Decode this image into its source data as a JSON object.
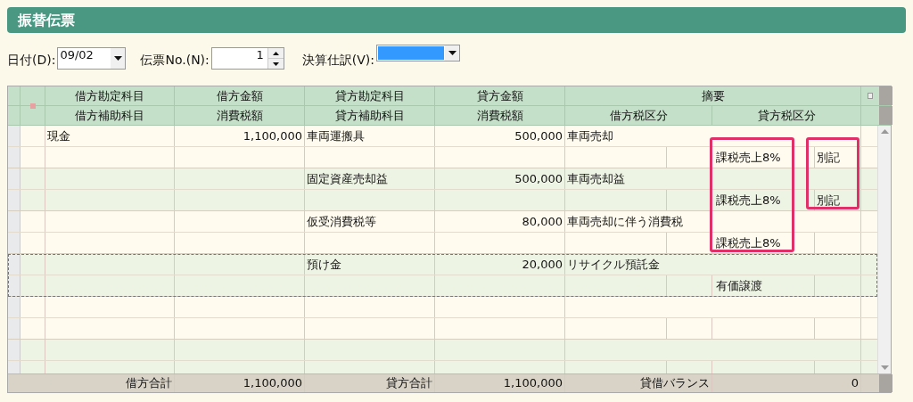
{
  "title": "振替伝票",
  "form": {
    "date": {
      "label": "日付(D):",
      "value": "09/02"
    },
    "slip_no": {
      "label": "伝票No.(N):",
      "value": "1"
    },
    "closing_entry": {
      "label": "決算仕訳(V):"
    }
  },
  "table": {
    "header_top": [
      "借方勘定科目",
      "借方金額",
      "貸方勘定科目",
      "貸方金額",
      "摘要"
    ],
    "header_bottom": [
      "借方補助科目",
      "消費税額",
      "貸方補助科目",
      "消費税額",
      "借方税区分",
      "貸方税区分"
    ],
    "entries": [
      {
        "debit_account": "現金",
        "debit_amount": "1,100,000",
        "credit_account": "車両運搬具",
        "credit_amount": "500,000",
        "summary": "車両売却",
        "credit_tax_1": "課税売上8%",
        "credit_tax_2": "別記",
        "selected": false,
        "tax_class_highlighted": true,
        "tax_note_highlighted": true
      },
      {
        "credit_account": "固定資産売却益",
        "credit_amount": "500,000",
        "summary": "車両売却益",
        "credit_tax_1": "課税売上8%",
        "credit_tax_2": "別記",
        "selected": false,
        "tax_class_highlighted": true,
        "tax_note_highlighted": true
      },
      {
        "credit_account": "仮受消費税等",
        "credit_amount": "80,000",
        "summary": "車両売却に伴う消費税",
        "credit_tax_1": "課税売上8%",
        "selected": false,
        "tax_class_highlighted": true,
        "tax_note_highlighted": false
      },
      {
        "credit_account": "預け金",
        "credit_amount": "20,000",
        "summary": "リサイクル預託金",
        "credit_tax_1": "有価譲渡",
        "selected": true,
        "tax_class_highlighted": false,
        "tax_note_highlighted": false
      },
      {
        "selected": false,
        "tax_class_highlighted": false,
        "tax_note_highlighted": false
      },
      {
        "selected": false,
        "tax_class_highlighted": false,
        "tax_note_highlighted": false
      }
    ],
    "footer": {
      "debit_total_label": "借方合計",
      "debit_total": "1,100,000",
      "credit_total_label": "貸方合計",
      "credit_total": "1,100,000",
      "balance_label": "貸借バランス",
      "balance": "0"
    }
  }
}
